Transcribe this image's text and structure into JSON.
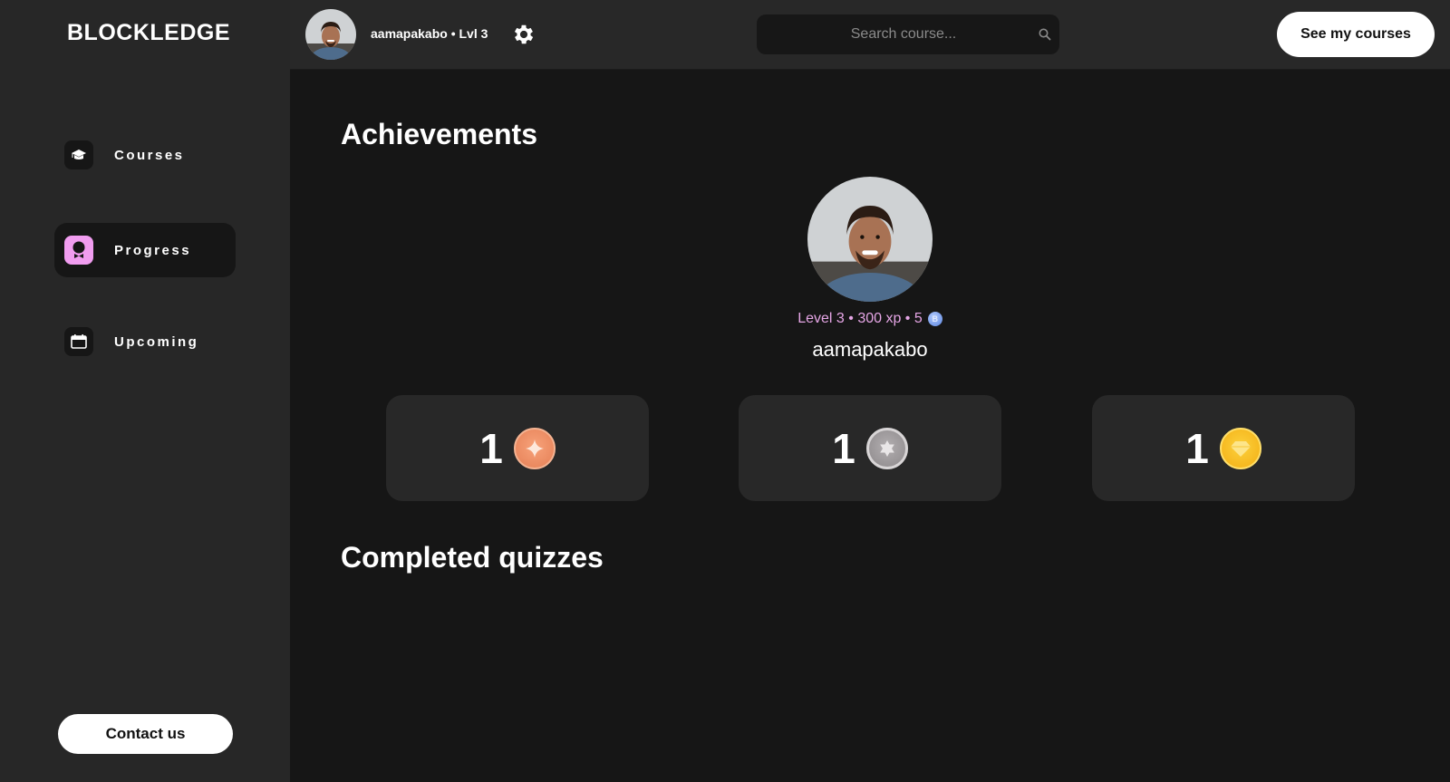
{
  "app": {
    "logo": "BLOCKLEDGE"
  },
  "sidebar": {
    "items": [
      {
        "label": "Courses",
        "icon": "graduation-cap-icon",
        "active": false
      },
      {
        "label": "Progress",
        "icon": "award-ribbon-icon",
        "active": true
      },
      {
        "label": "Upcoming",
        "icon": "calendar-icon",
        "active": false
      }
    ],
    "contact_label": "Contact us"
  },
  "topbar": {
    "user_label": "aamapakabo • Lvl 3",
    "search_placeholder": "Search course...",
    "see_courses_label": "See my courses"
  },
  "main": {
    "achievements_title": "Achievements",
    "profile": {
      "stats": "Level 3 • 300 xp • 5",
      "coin_glyph": "B",
      "username": "aamapakabo"
    },
    "badges": [
      {
        "count": "1",
        "type": "bronze"
      },
      {
        "count": "1",
        "type": "silver"
      },
      {
        "count": "1",
        "type": "gold"
      }
    ],
    "completed_title": "Completed quizzes"
  },
  "colors": {
    "accent_pink": "#f19df0",
    "stats_text": "#e6a6e6",
    "bronze": "#f29068",
    "silver": "#a09c9e",
    "gold": "#f8c12a"
  }
}
